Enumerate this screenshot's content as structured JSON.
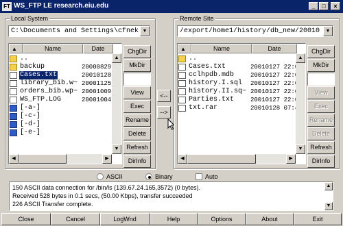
{
  "window": {
    "title": "WS_FTP LE research.eiu.edu",
    "app_icon": "FT",
    "minimize_glyph": "_",
    "maximize_glyph": "□",
    "close_glyph": "×"
  },
  "local": {
    "group_label": "Local System",
    "path": "C:\\Documents and Settings\\cfnek",
    "col_name": "Name",
    "col_date": "Date",
    "files": [
      {
        "name": "..",
        "date": "",
        "icon": "up-folder-icon"
      },
      {
        "name": "backup",
        "date": "20000829 2",
        "icon": "folder-icon"
      },
      {
        "name": "Cases.txt",
        "date": "20010128 1",
        "icon": "file-icon",
        "selected": true
      },
      {
        "name": "library_bib.w~",
        "date": "20001125 1",
        "icon": "file-icon"
      },
      {
        "name": "orders_bib.wp~",
        "date": "20001009 1",
        "icon": "file-icon"
      },
      {
        "name": "WS_FTP.LOG",
        "date": "20001004 1",
        "icon": "file-icon"
      },
      {
        "name": "[-a-]",
        "date": "",
        "icon": "drive-icon"
      },
      {
        "name": "[-c-]",
        "date": "",
        "icon": "drive-icon"
      },
      {
        "name": "[-d-]",
        "date": "",
        "icon": "drive-icon"
      },
      {
        "name": "[-e-]",
        "date": "",
        "icon": "drive-icon"
      }
    ],
    "buttons": {
      "chgdir": "ChgDir",
      "mkdir": "MkDir",
      "view": "View",
      "exec": "Exec",
      "rename": "Rename",
      "delete": "Delete",
      "refresh": "Refresh",
      "dirinfo": "DirInfo"
    }
  },
  "remote": {
    "group_label": "Remote Site",
    "path": "/export/home1/history/db_new/20010",
    "col_name": "Name",
    "col_date": "Date",
    "files": [
      {
        "name": "..",
        "date": "",
        "icon": "up-folder-icon"
      },
      {
        "name": "Cases.txt",
        "date": "20010127 22:0",
        "icon": "file-icon"
      },
      {
        "name": "cclhpdb.mdb",
        "date": "20010127 22:0",
        "icon": "file-icon"
      },
      {
        "name": "history.I.sql",
        "date": "20010127 22:0",
        "icon": "file-icon"
      },
      {
        "name": "history.II.sq~",
        "date": "20010127 22:0",
        "icon": "file-icon"
      },
      {
        "name": "Parties.txt",
        "date": "20010127 22:0",
        "icon": "file-icon"
      },
      {
        "name": "txt.rar",
        "date": "20010128 07:4",
        "icon": "file-icon"
      }
    ],
    "buttons": {
      "chgdir": "ChgDir",
      "mkdir": "MkDir",
      "view": "View",
      "exec": "Exec",
      "rename": "Rename",
      "delete": "Delete",
      "refresh": "Refresh",
      "dirinfo": "DirInfo"
    },
    "disabled_buttons": [
      "view",
      "exec",
      "rename",
      "delete"
    ]
  },
  "transfer": {
    "to_local": "<--",
    "to_remote": "-->"
  },
  "mode": {
    "ascii": "ASCII",
    "binary": "Binary",
    "auto": "Auto",
    "selected": "binary",
    "auto_checked": false
  },
  "log": {
    "lines": [
      "150 ASCII data connection for /bin/ls (139.67.24.165,3572) (0 bytes).",
      "Received 528 bytes in 0.1 secs, (50.00 Kbps), transfer succeeded",
      "226 ASCII Transfer complete."
    ]
  },
  "bottom_bar": {
    "close": "Close",
    "cancel": "Cancel",
    "logwnd": "LogWnd",
    "help": "Help",
    "options": "Options",
    "about": "About",
    "exit": "Exit"
  },
  "scroll_glyphs": {
    "up": "▲",
    "down": "▼",
    "left": "◀",
    "right": "▶"
  },
  "header_up_glyph": "▲"
}
